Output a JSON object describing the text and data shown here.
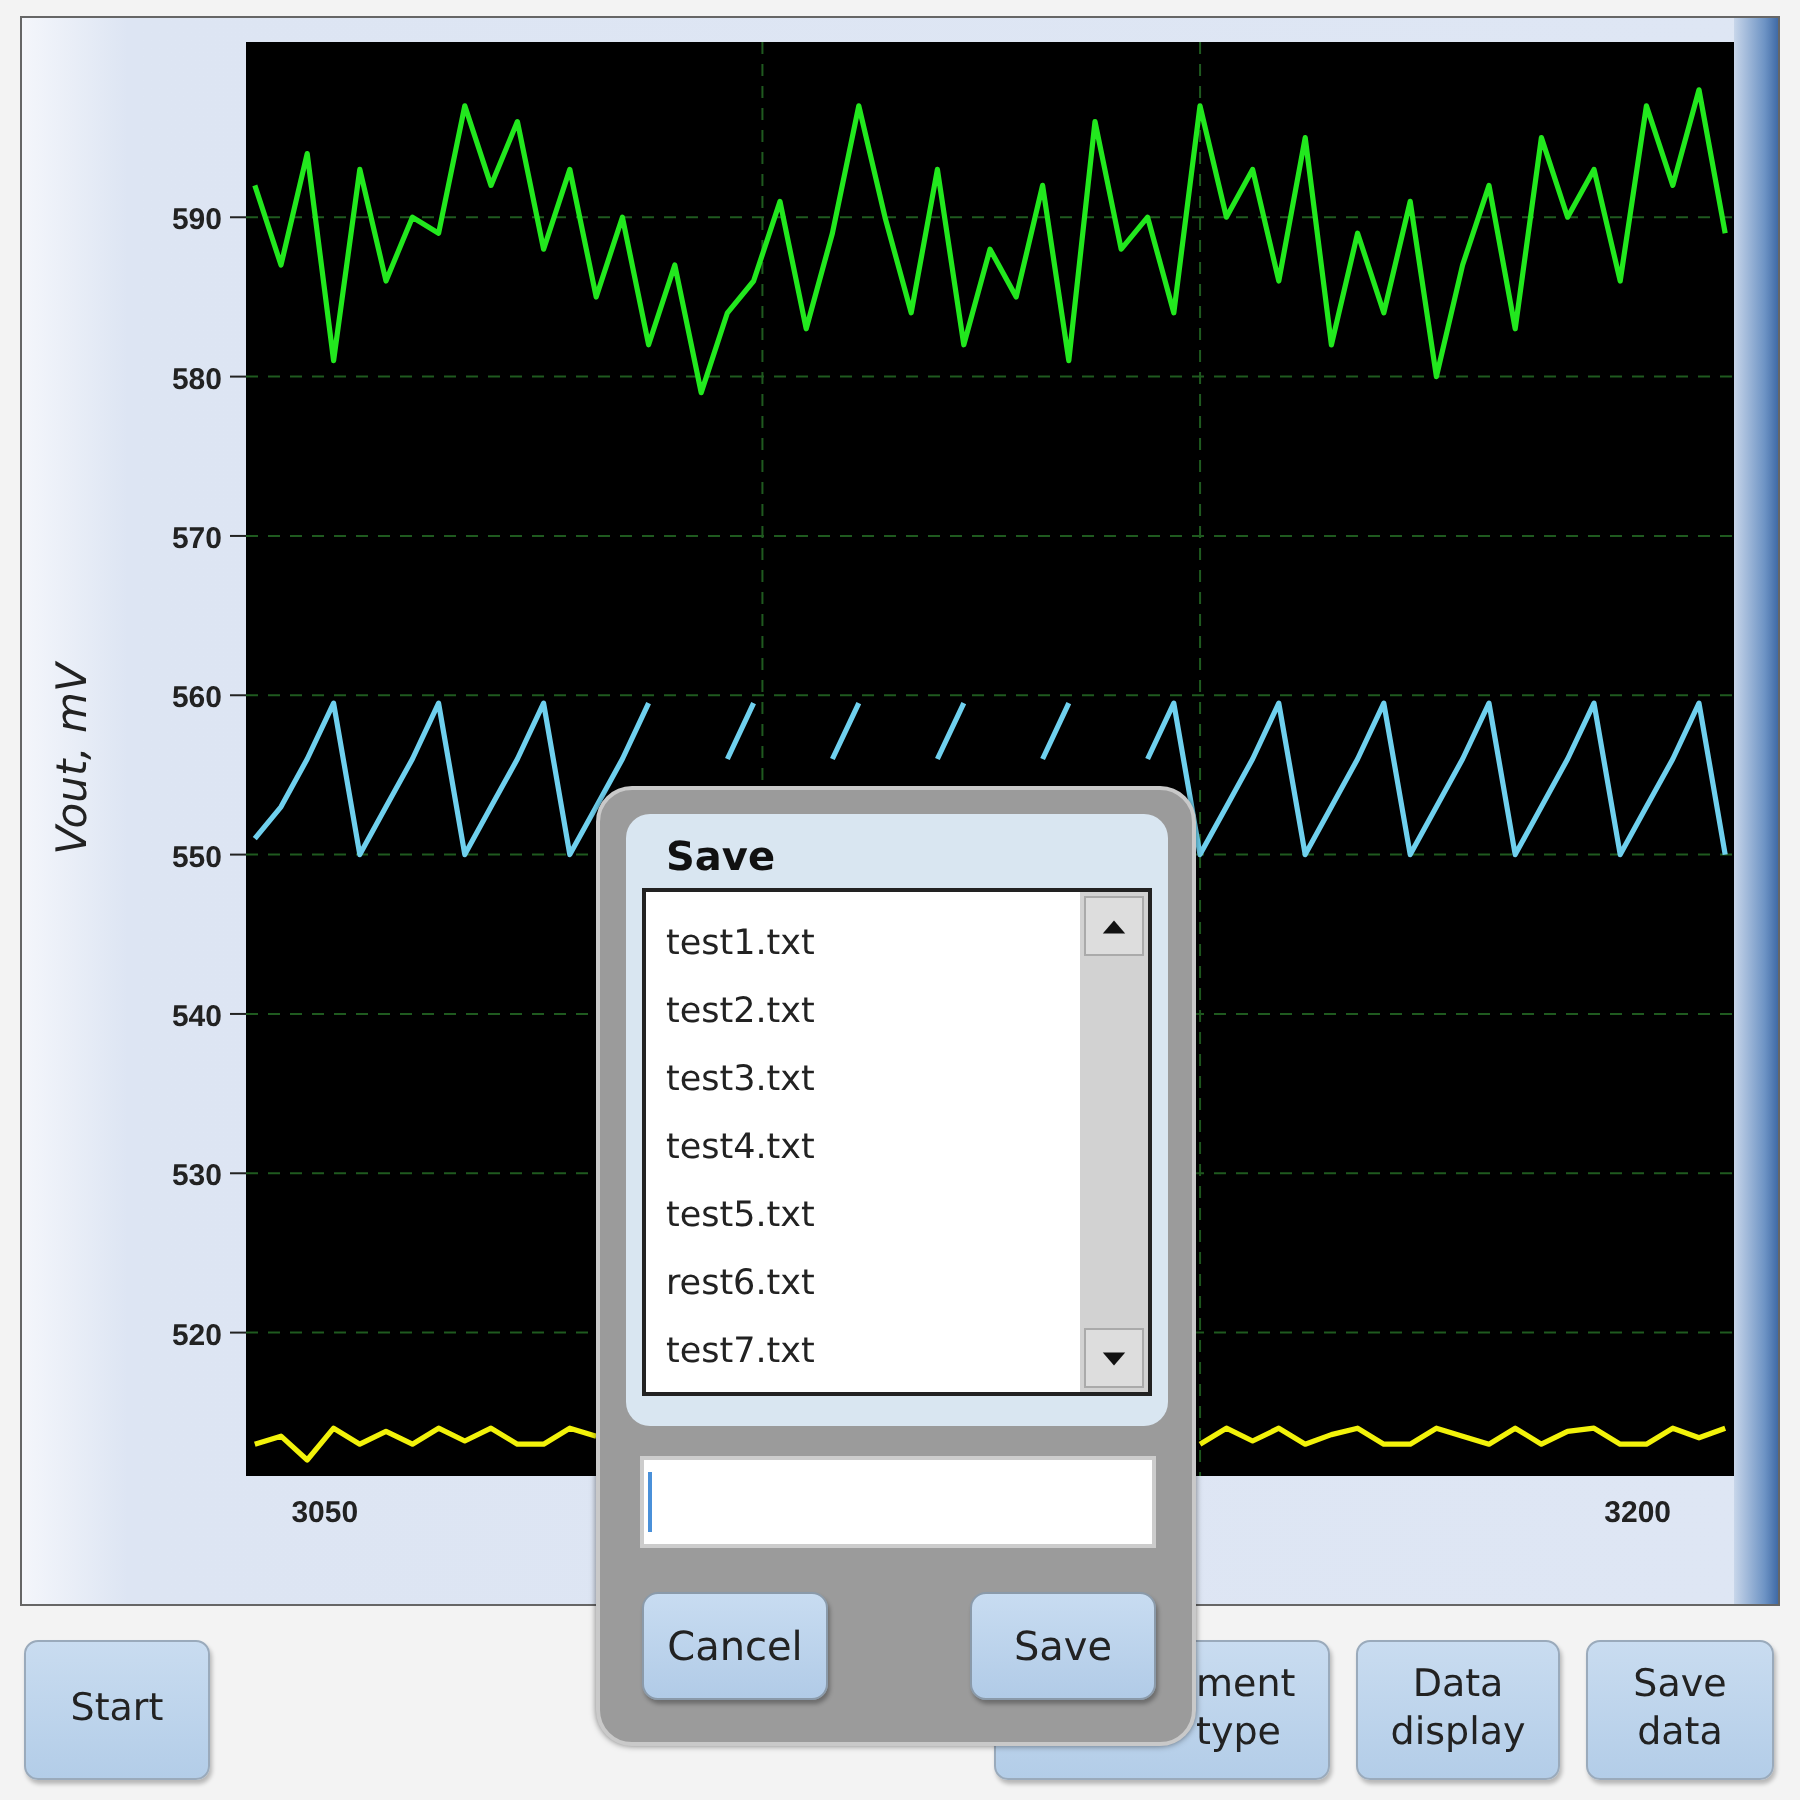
{
  "chart_panel": {
    "chart_data": {
      "type": "line",
      "ylabel": "Vout, mV",
      "grid": true,
      "xlim": [
        3041,
        3211
      ],
      "ylim": [
        511,
        601
      ],
      "yticks": [
        520,
        530,
        540,
        550,
        560,
        570,
        580,
        590
      ],
      "xticks": [
        3050,
        3200
      ],
      "x": [
        3042,
        3045,
        3048,
        3051,
        3054,
        3057,
        3060,
        3063,
        3066,
        3069,
        3072,
        3075,
        3078,
        3081,
        3084,
        3087,
        3090,
        3093,
        3096,
        3099,
        3102,
        3105,
        3108,
        3111,
        3114,
        3117,
        3120,
        3123,
        3126,
        3129,
        3132,
        3135,
        3138,
        3141,
        3144,
        3147,
        3150,
        3153,
        3156,
        3159,
        3162,
        3165,
        3168,
        3171,
        3174,
        3177,
        3180,
        3183,
        3186,
        3189,
        3192,
        3195,
        3198,
        3201,
        3204,
        3207,
        3210
      ],
      "series": [
        {
          "color": "#22e81e",
          "values": [
            592,
            587,
            594,
            581,
            593,
            586,
            590,
            589,
            597,
            592,
            596,
            588,
            593,
            585,
            590,
            582,
            587,
            579,
            584,
            586,
            591,
            583,
            589,
            597,
            590,
            584,
            593,
            582,
            588,
            585,
            592,
            581,
            596,
            588,
            590,
            584,
            597,
            590,
            593,
            586,
            595,
            582,
            589,
            584,
            591,
            580,
            587,
            592,
            583,
            595,
            590,
            593,
            586,
            597,
            592,
            598,
            589
          ]
        },
        {
          "color": "#6fd0ee",
          "values": [
            551,
            553,
            556,
            559.5,
            550,
            553,
            556,
            559.5,
            550,
            553,
            556,
            559.5,
            550,
            553,
            556,
            559.5,
            null,
            null,
            556,
            559.5,
            null,
            null,
            556,
            559.5,
            null,
            null,
            556,
            559.5,
            null,
            null,
            556,
            559.5,
            null,
            null,
            556,
            559.5,
            550,
            553,
            556,
            559.5,
            550,
            553,
            556,
            559.5,
            550,
            553,
            556,
            559.5,
            550,
            553,
            556,
            559.5,
            550,
            553,
            556,
            559.5,
            550
          ]
        },
        {
          "color": "#f2f20a",
          "values": [
            513,
            513.5,
            512,
            514,
            513,
            513.8,
            513,
            514,
            513.2,
            514,
            513,
            513,
            514,
            513.5,
            null,
            null,
            null,
            null,
            null,
            null,
            null,
            null,
            null,
            null,
            null,
            null,
            null,
            null,
            null,
            null,
            null,
            null,
            null,
            null,
            null,
            null,
            513,
            514,
            513.2,
            514,
            513,
            513.6,
            514,
            513,
            513,
            514,
            513.5,
            513,
            514,
            513,
            513.8,
            514,
            513,
            513,
            514,
            513.4,
            514
          ]
        }
      ]
    }
  },
  "buttons": [
    {
      "label": "Start"
    },
    {
      "label": "ment type"
    },
    {
      "label": "Data display"
    },
    {
      "label": "Save data"
    }
  ],
  "dialog": {
    "title": "Save",
    "files": [
      "test1.txt",
      "test2.txt",
      "test3.txt",
      "test4.txt",
      "test5.txt",
      "rest6.txt",
      "test7.txt"
    ],
    "actions": [
      "Cancel",
      "Save"
    ]
  }
}
